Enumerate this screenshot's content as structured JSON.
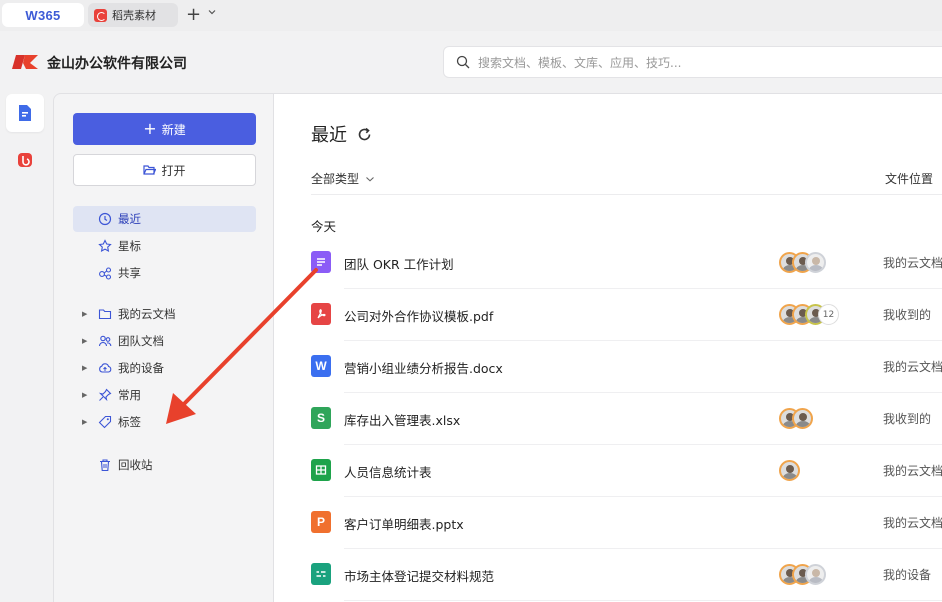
{
  "tabs": {
    "home_label": "W365",
    "second_label": "稻壳素材",
    "add_label": "+"
  },
  "header": {
    "company": "金山办公软件有限公司",
    "search_placeholder": "搜索文档、模板、文库、应用、技巧..."
  },
  "sidebar": {
    "new_label": "新建",
    "open_label": "打开",
    "nav": [
      {
        "label": "最近",
        "icon": "clock-icon",
        "active": true
      },
      {
        "label": "星标",
        "icon": "star-icon"
      },
      {
        "label": "共享",
        "icon": "share-icon"
      }
    ],
    "tree": [
      {
        "label": "我的云文档",
        "icon": "folder-icon"
      },
      {
        "label": "团队文档",
        "icon": "team-icon"
      },
      {
        "label": "我的设备",
        "icon": "cloud-icon"
      },
      {
        "label": "常用",
        "icon": "pin-icon"
      },
      {
        "label": "标签",
        "icon": "tag-icon"
      }
    ],
    "trash_label": "回收站"
  },
  "main": {
    "title": "最近",
    "filter_label": "全部类型",
    "location_header": "文件位置",
    "section_today": "今天",
    "files": [
      {
        "name": "团队 OKR 工作计划",
        "type": "doc",
        "icon_color": "#8b5cf6",
        "location": "我的云文档",
        "avatars": 3
      },
      {
        "name": "公司对外合作协议模板.pdf",
        "type": "pdf",
        "icon_color": "#e64545",
        "location": "我收到的",
        "avatars": 3,
        "extra_count": "12"
      },
      {
        "name": "营销小组业绩分析报告.docx",
        "type": "word",
        "icon_color": "#3b6ff0",
        "icon_letter": "W",
        "location": "我的云文档",
        "avatars": 0
      },
      {
        "name": "库存出入管理表.xlsx",
        "type": "sheet",
        "icon_color": "#2fa55a",
        "icon_letter": "S",
        "location": "我收到的",
        "avatars": 2
      },
      {
        "name": "人员信息统计表",
        "type": "table",
        "icon_color": "#1ea34b",
        "location": "我的云文档",
        "avatars": 1
      },
      {
        "name": "客户订单明细表.pptx",
        "type": "ppt",
        "icon_color": "#f0702e",
        "icon_letter": "P",
        "location": "我的云文档",
        "avatars": 0
      },
      {
        "name": "市场主体登记提交材料规范",
        "type": "form",
        "icon_color": "#1aa27e",
        "location": "我的设备",
        "avatars": 3
      }
    ]
  },
  "colors": {
    "accent": "#4a5ee0",
    "annotation_arrow": "#e8412c"
  }
}
